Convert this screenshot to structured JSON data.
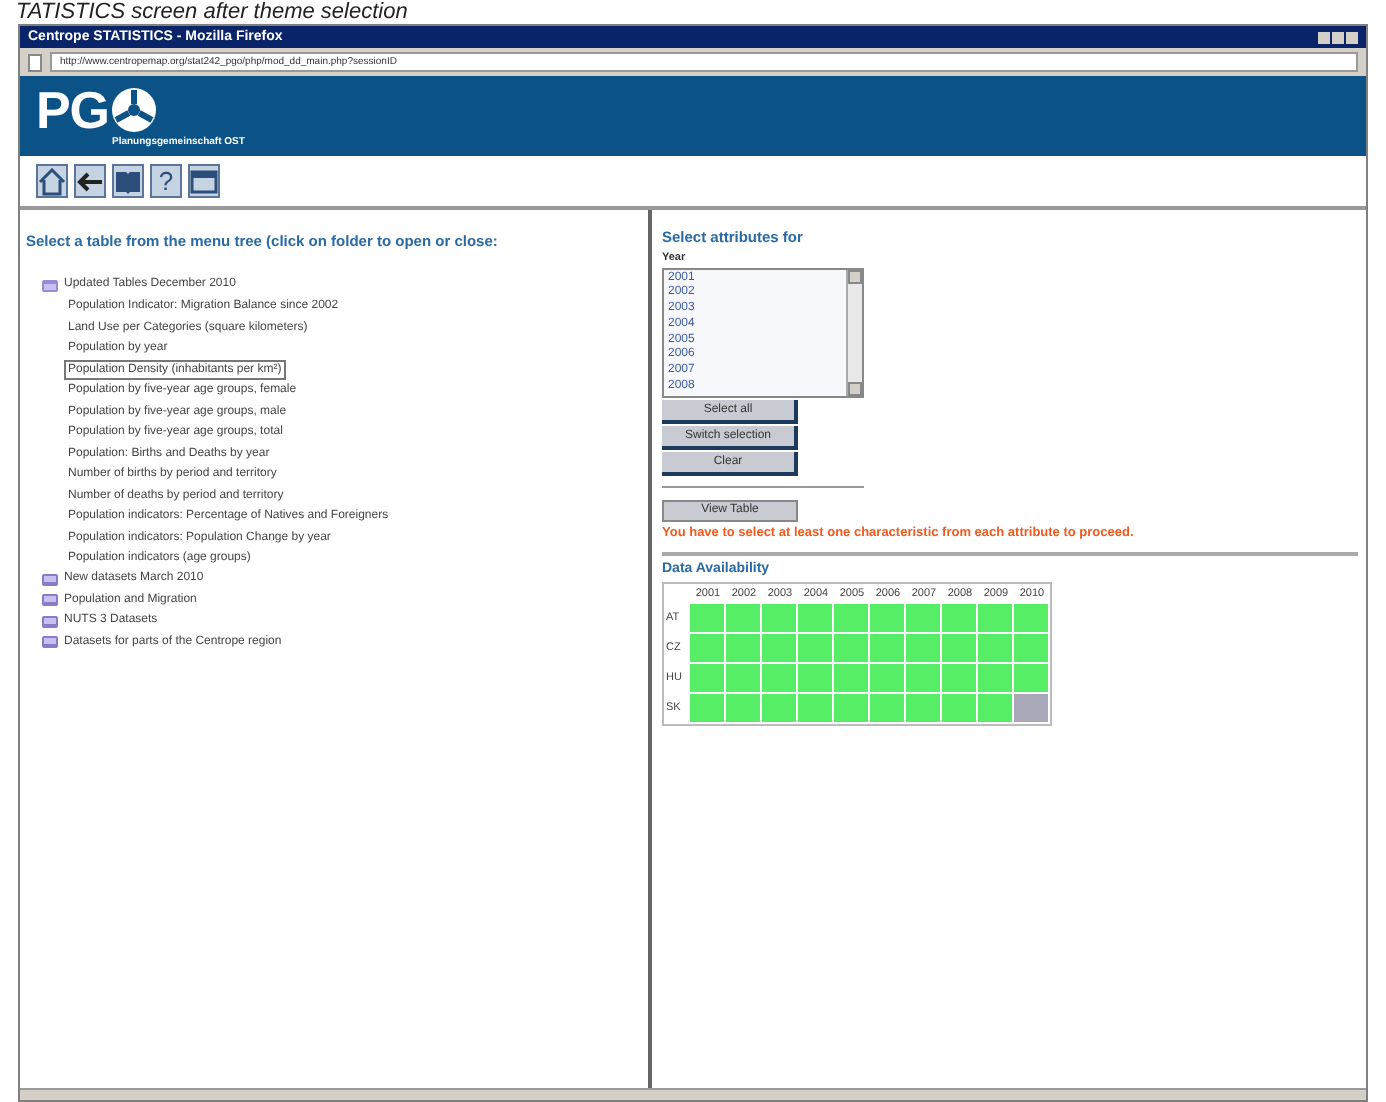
{
  "caption": "TATISTICS screen after theme selection",
  "window": {
    "title": "Centrope STATISTICS - Mozilla Firefox",
    "url": "http://www.centropemap.org/stat242_pgo/php/mod_dd_main.php?sessionID"
  },
  "banner": {
    "logo": "PG",
    "subtitle": "Planungsgemeinschaft OST"
  },
  "toolbar": [
    {
      "kind": "home"
    },
    {
      "kind": "back"
    },
    {
      "kind": "book"
    },
    {
      "kind": "help",
      "label": "?"
    },
    {
      "kind": "window"
    }
  ],
  "menu_tree": {
    "heading": "Select a table from the menu tree (click on folder to open or close:",
    "items": [
      {
        "label": "Updated Tables December 2010",
        "expanded": true,
        "children": [
          {
            "label": "Population Indicator: Migration Balance since 2002",
            "selected": false
          },
          {
            "label": "Land Use per Categories (square kilometers)",
            "selected": false
          },
          {
            "label": "Population by year",
            "selected": false
          },
          {
            "label": "Population Density (inhabitants per km²)",
            "selected": true
          },
          {
            "label": "Population by five-year age groups, female",
            "selected": false
          },
          {
            "label": "Population by five-year age groups, male",
            "selected": false
          },
          {
            "label": "Population by five-year age groups, total",
            "selected": false
          },
          {
            "label": "Population: Births and Deaths by year",
            "selected": false
          },
          {
            "label": "Number of births by period and territory",
            "selected": false
          },
          {
            "label": "Number of deaths by period and territory",
            "selected": false
          },
          {
            "label": "Population indicators: Percentage of Natives and Foreigners",
            "selected": false
          },
          {
            "label": "Population indicators: Population Change by year",
            "selected": false
          },
          {
            "label": "Population indicators (age groups)",
            "selected": false
          }
        ]
      },
      {
        "label": "New datasets March 2010",
        "expanded": false
      },
      {
        "label": "Population and Migration",
        "expanded": false
      },
      {
        "label": "NUTS 3 Datasets",
        "expanded": false
      },
      {
        "label": "Datasets for parts of the Centrope region",
        "expanded": false
      }
    ]
  },
  "attributes": {
    "heading": "Select attributes for",
    "field_label": "Year",
    "options": [
      "2001",
      "2002",
      "2003",
      "2004",
      "2005",
      "2006",
      "2007",
      "2008"
    ],
    "buttons": [
      "Select all",
      "Switch selection",
      "Clear"
    ],
    "view_button": "View Table",
    "warning": "You have to select at least one characteristic from each attribute to proceed."
  },
  "availability": {
    "heading": "Data Availability",
    "years": [
      "2001",
      "2002",
      "2003",
      "2004",
      "2005",
      "2006",
      "2007",
      "2008",
      "2009",
      "2010"
    ],
    "rows": [
      {
        "label": "AT",
        "available": [
          true,
          true,
          true,
          true,
          true,
          true,
          true,
          true,
          true,
          true
        ]
      },
      {
        "label": "CZ",
        "available": [
          true,
          true,
          true,
          true,
          true,
          true,
          true,
          true,
          true,
          true
        ]
      },
      {
        "label": "HU",
        "available": [
          true,
          true,
          true,
          true,
          true,
          true,
          true,
          true,
          true,
          true
        ]
      },
      {
        "label": "SK",
        "available": [
          true,
          true,
          true,
          true,
          true,
          true,
          true,
          true,
          true,
          false
        ]
      }
    ]
  }
}
